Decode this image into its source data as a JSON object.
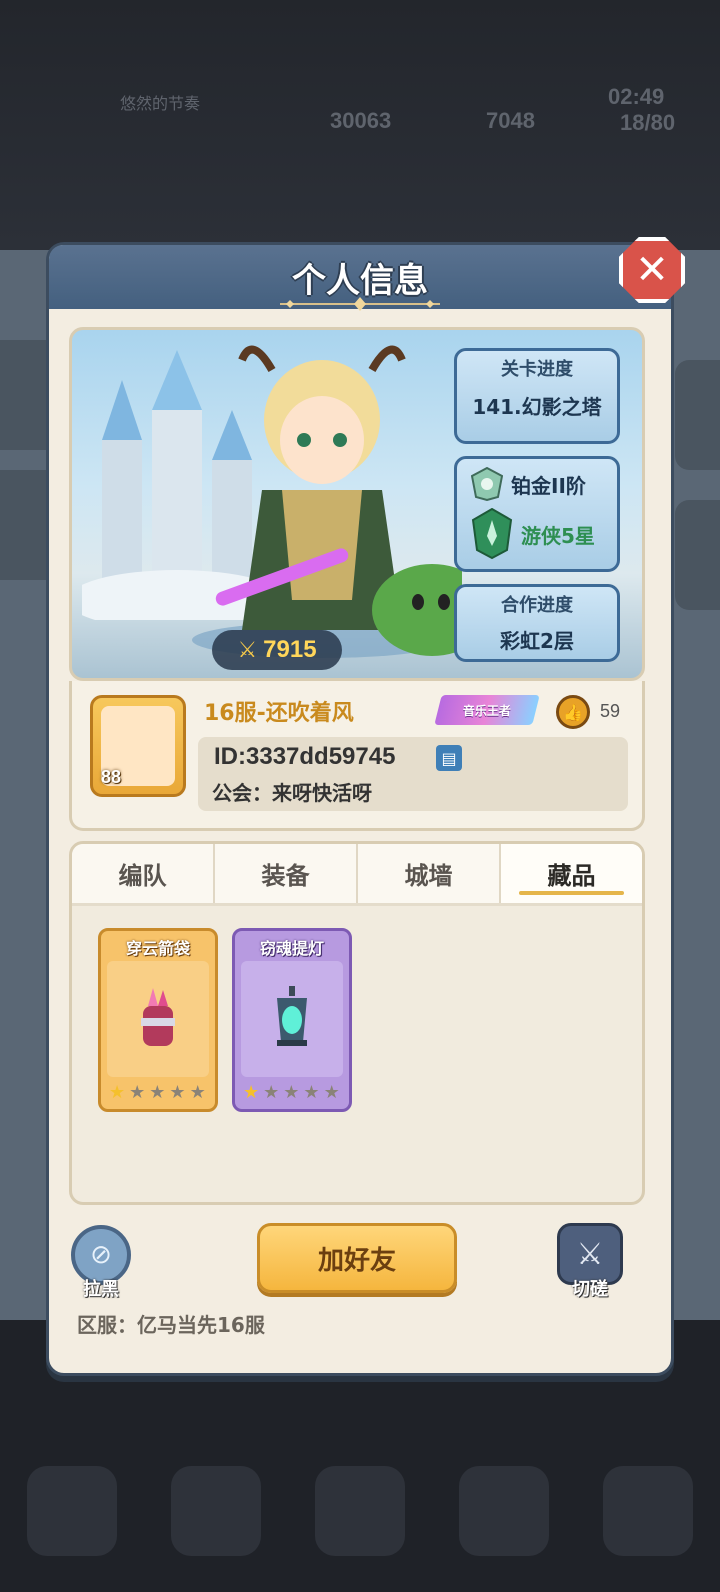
{
  "background": {
    "hud_player_name": "悠然的节奏",
    "hud_gems": "30063",
    "hud_gold": "7048",
    "hud_time": "02:49",
    "hud_energy": "18/80"
  },
  "modal": {
    "title": "个人信息",
    "close_icon": "close-icon"
  },
  "portrait": {
    "power": "7915",
    "stage_label": "关卡进度",
    "stage_value": "141.幻影之塔",
    "rank_tier": "铂金II阶",
    "rank_class": "游侠5星",
    "coop_label": "合作进度",
    "coop_value": "彩虹2层"
  },
  "profile": {
    "avatar_level": "88",
    "name": "16服-还吹着风",
    "title_badge": "音乐王者",
    "likes": "59",
    "id": "ID:3337dd59745",
    "guild": "公会：来呀快活呀"
  },
  "tabs": [
    {
      "label": "编队"
    },
    {
      "label": "装备"
    },
    {
      "label": "城墙"
    },
    {
      "label": "藏品"
    }
  ],
  "active_tab": "藏品",
  "items": [
    {
      "name": "穿云箭袋",
      "rarity": "orange",
      "stars": 1,
      "max_stars": 5
    },
    {
      "name": "窃魂提灯",
      "rarity": "purple",
      "stars": 1,
      "max_stars": 5
    }
  ],
  "actions": {
    "block_label": "拉黑",
    "add_friend_label": "加好友",
    "duel_label": "切磋"
  },
  "server": "区服：亿马当先16服",
  "colors": {
    "accent_gold": "#f5b63e",
    "header_blue": "#44607f",
    "close_red": "#d9534a",
    "name_gold": "#c98a1e"
  }
}
